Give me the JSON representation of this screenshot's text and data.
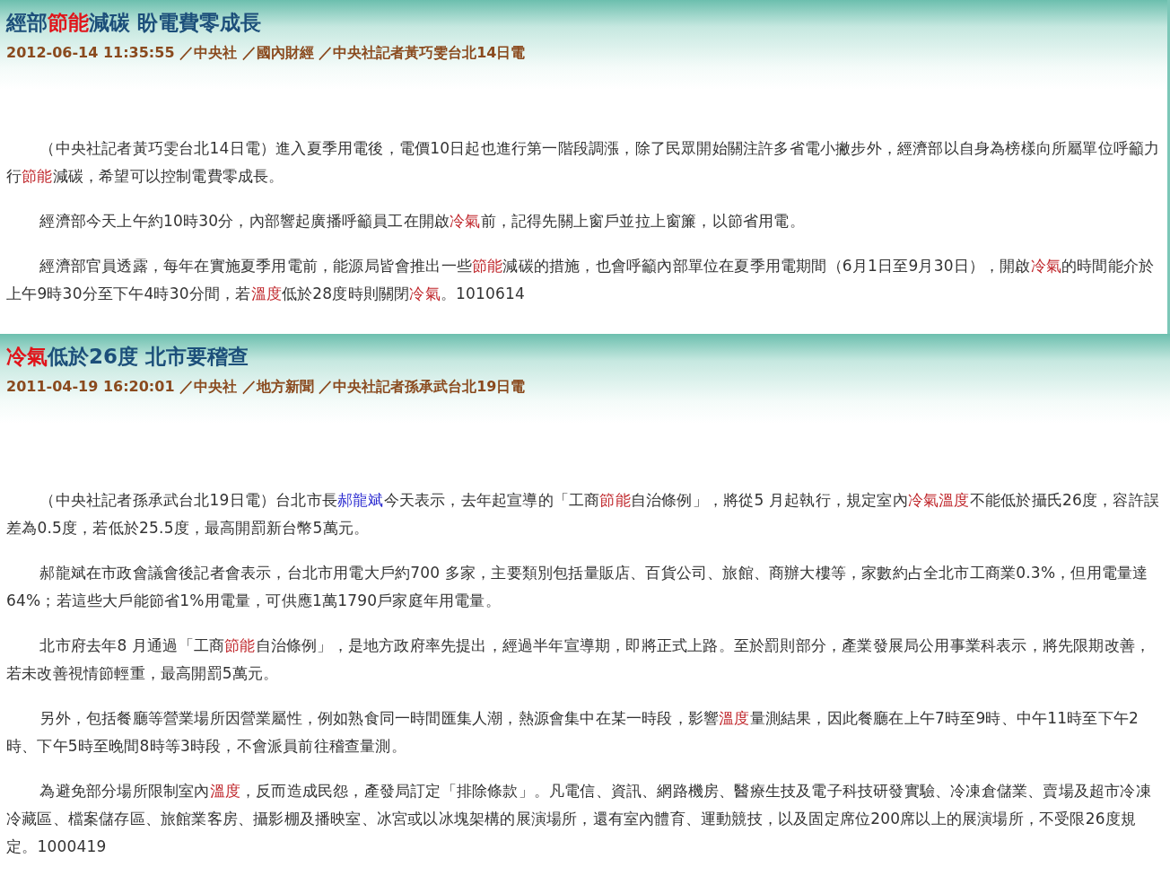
{
  "articles": [
    {
      "title": [
        {
          "text": "經部",
          "kind": "plain"
        },
        {
          "text": "節能",
          "kind": "keyword"
        },
        {
          "text": "減碳 盼電費零成長",
          "kind": "plain"
        }
      ],
      "meta": "2012-06-14 11:35:55 ／中央社 ／國內財經 ／中央社記者黃巧雯台北14日電",
      "paragraphs": [
        [
          {
            "text": "（中央社記者黃巧雯台北14日電）進入夏季用電後，電價10日起也進行第一階段調漲，除了民眾開始關注許多省電小撇步外，經濟部以自身為榜樣向所屬單位呼籲力行",
            "kind": "plain"
          },
          {
            "text": "節能",
            "kind": "keyword"
          },
          {
            "text": "減碳，希望可以控制電費零成長。",
            "kind": "plain"
          }
        ],
        [
          {
            "text": "經濟部今天上午約10時30分，內部響起廣播呼籲員工在開啟",
            "kind": "plain"
          },
          {
            "text": "冷氣",
            "kind": "keyword"
          },
          {
            "text": "前，記得先關上窗戶並拉上窗簾，以節省用電。",
            "kind": "plain"
          }
        ],
        [
          {
            "text": "經濟部官員透露，每年在實施夏季用電前，能源局皆會推出一些",
            "kind": "plain"
          },
          {
            "text": "節能",
            "kind": "keyword"
          },
          {
            "text": "減碳的措施，也會呼籲內部單位在夏季用電期間（6月1日至9月30日），開啟",
            "kind": "plain"
          },
          {
            "text": "冷氣",
            "kind": "keyword"
          },
          {
            "text": "的時間能介於上午9時30分至下午4時30分間，若",
            "kind": "plain"
          },
          {
            "text": "溫度",
            "kind": "keyword"
          },
          {
            "text": "低於28度時則關閉",
            "kind": "plain"
          },
          {
            "text": "冷氣",
            "kind": "keyword"
          },
          {
            "text": "。1010614",
            "kind": "plain"
          }
        ]
      ]
    },
    {
      "title": [
        {
          "text": "冷氣",
          "kind": "keyword"
        },
        {
          "text": "低於26度 北市要稽查",
          "kind": "plain"
        }
      ],
      "meta": "2011-04-19 16:20:01 ／中央社 ／地方新聞 ／中央社記者孫承武台北19日電",
      "paragraphs": [
        [
          {
            "text": "（中央社記者孫承武台北19日電）台北市長",
            "kind": "plain"
          },
          {
            "text": "郝龍斌",
            "kind": "link"
          },
          {
            "text": "今天表示，去年起宣導的「工商",
            "kind": "plain"
          },
          {
            "text": "節能",
            "kind": "keyword"
          },
          {
            "text": "自治條例」，將從5 月起執行，規定室內",
            "kind": "plain"
          },
          {
            "text": "冷氣溫度",
            "kind": "keyword"
          },
          {
            "text": "不能低於攝氏26度，容許誤差為0.5度，若低於25.5度，最高開罰新台幣5萬元。",
            "kind": "plain"
          }
        ],
        [
          {
            "text": "郝龍斌在市政會議會後記者會表示，台北市用電大戶約700 多家，主要類別包括量販店、百貨公司、旅館、商辦大樓等，家數約占全北市工商業0.3%，但用電量達64%；若這些大戶能節省1%用電量，可供應1萬1790戶家庭年用電量。",
            "kind": "plain"
          }
        ],
        [
          {
            "text": "北市府去年8 月通過「工商",
            "kind": "plain"
          },
          {
            "text": "節能",
            "kind": "keyword"
          },
          {
            "text": "自治條例」，是地方政府率先提出，經過半年宣導期，即將正式上路。至於罰則部分，產業發展局公用事業科表示，將先限期改善，若未改善視情節輕重，最高開罰5萬元。",
            "kind": "plain"
          }
        ],
        [
          {
            "text": "另外，包括餐廳等營業場所因營業屬性，例如熟食同一時間匯集人潮，熱源會集中在某一時段，影響",
            "kind": "plain"
          },
          {
            "text": "溫度",
            "kind": "keyword"
          },
          {
            "text": "量測結果，因此餐廳在上午7時至9時、中午11時至下午2時、下午5時至晚間8時等3時段，不會派員前往稽查量測。",
            "kind": "plain"
          }
        ],
        [
          {
            "text": "為避免部分場所限制室內",
            "kind": "plain"
          },
          {
            "text": "溫度",
            "kind": "keyword"
          },
          {
            "text": "，反而造成民怨，產發局訂定「排除條款」。凡電信、資訊、網路機房、醫療生技及電子科技研發實驗、冷凍倉儲業、賣場及超市冷凍冷藏區、檔案儲存區、旅館業客房、攝影棚及播映室、冰宮或以冰塊架構的展演場所，還有室內體育、運動競技，以及固定席位200席以上的展演場所，不受限26度規定。1000419",
            "kind": "plain"
          }
        ]
      ]
    }
  ]
}
